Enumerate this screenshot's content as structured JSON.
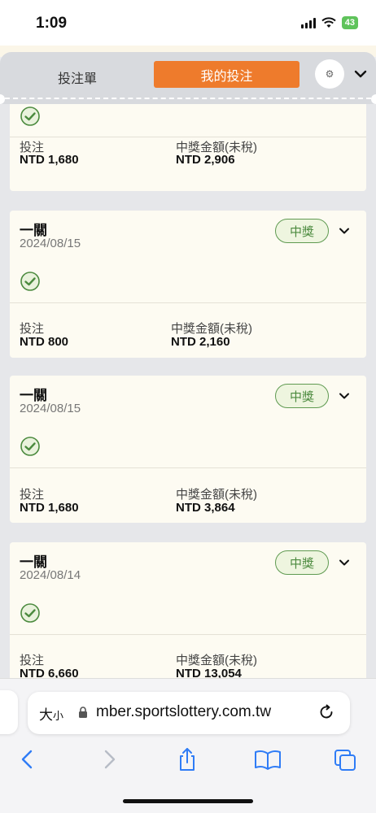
{
  "status_bar": {
    "time": "1:09",
    "battery": "43"
  },
  "tabs": {
    "betslip": "投注單",
    "my_bets": "我的投注"
  },
  "gear_icon": "⚙",
  "labels": {
    "stake": "投注",
    "payout": "中獎金額(未稅)",
    "win": "中獎"
  },
  "cards": [
    {
      "title": "",
      "date": "",
      "stake": "NTD 1,680",
      "payout": "NTD 2,906"
    },
    {
      "title": "一關",
      "date": "2024/08/15",
      "status": "中獎",
      "stake": "NTD 800",
      "payout": "NTD 2,160"
    },
    {
      "title": "一關",
      "date": "2024/08/15",
      "status": "中獎",
      "stake": "NTD 1,680",
      "payout": "NTD 3,864"
    },
    {
      "title": "一關",
      "date": "2024/08/14",
      "status": "中獎",
      "stake": "NTD 6,660",
      "payout": "NTD 13,054"
    }
  ],
  "browser": {
    "text_size": "大",
    "text_size_small": "小",
    "url": "mber.sportslottery.com.tw"
  },
  "colors": {
    "accent": "#ee7b2c",
    "win_green": "#4b8a3e",
    "card_bg": "#fdfbf2"
  }
}
